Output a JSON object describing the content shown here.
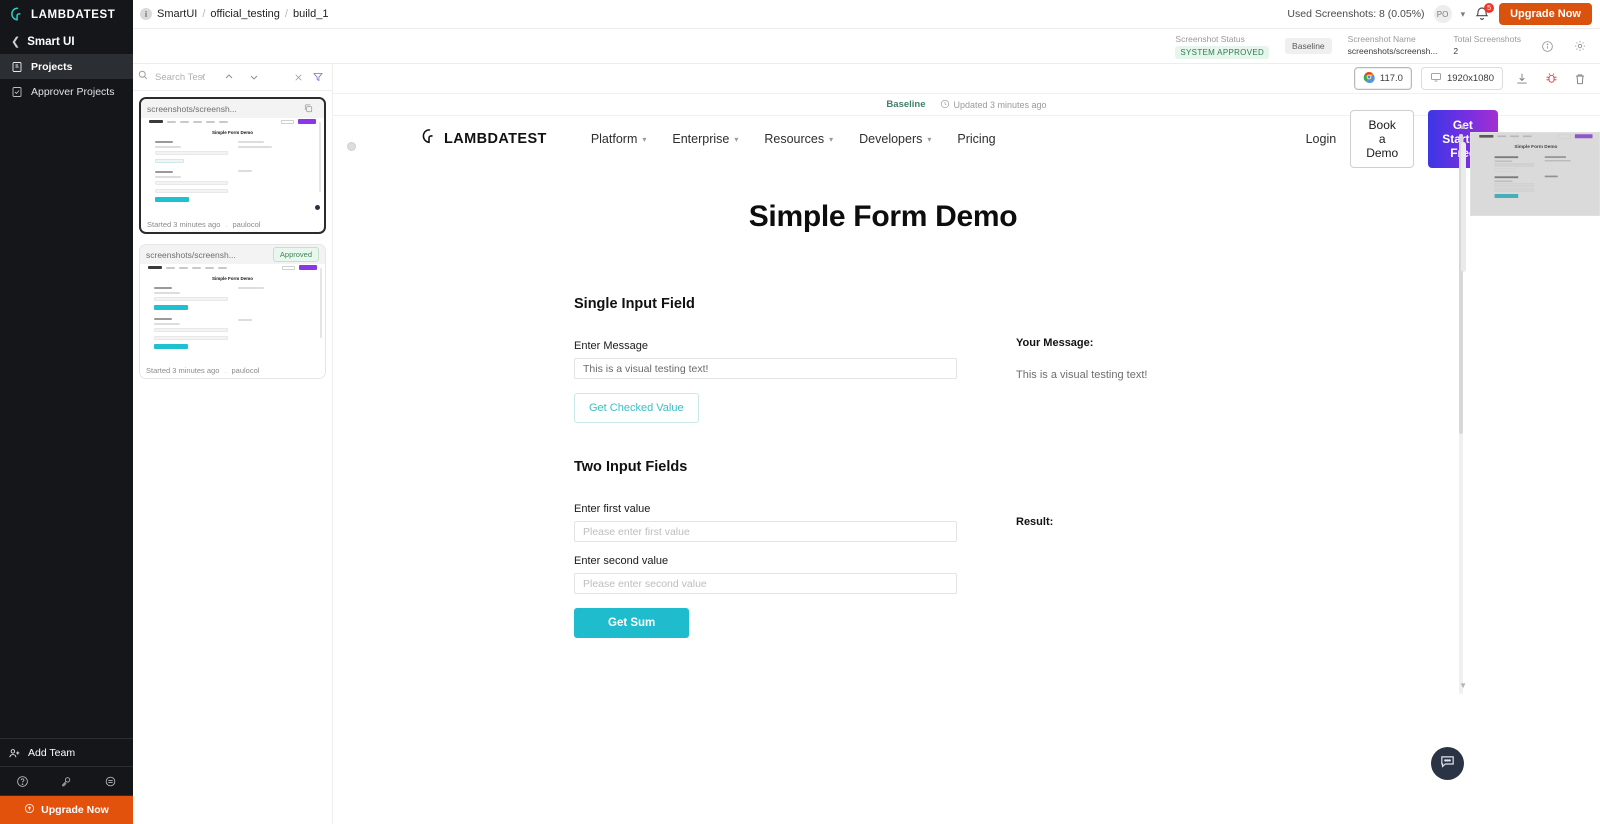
{
  "sidebar": {
    "brand": "LAMBDATEST",
    "back_label": "Smart UI",
    "items": [
      {
        "label": "Projects",
        "icon": "document-icon",
        "active": true
      },
      {
        "label": "Approver Projects",
        "icon": "document-check-icon",
        "active": false
      }
    ],
    "add_team": "Add Team",
    "upgrade": "Upgrade Now",
    "footer_icons": [
      "help-icon",
      "key-icon",
      "settings-icon"
    ]
  },
  "header": {
    "breadcrumb": {
      "root": "SmartUI",
      "project": "official_testing",
      "build": "build_1",
      "sep": "/"
    },
    "used_screenshots": "Used Screenshots: 8 (0.05%)",
    "avatar_initials": "PO",
    "notification_count": "5",
    "upgrade_button": "Upgrade Now"
  },
  "meta": {
    "status_label": "Screenshot Status",
    "status_value": "SYSTEM APPROVED",
    "baseline_badge": "Baseline",
    "name_label": "Screenshot Name",
    "name_value": "screenshots/screensh...",
    "total_label": "Total Screenshots",
    "total_value": "2",
    "info_icon": "info-icon",
    "settings_icon": "gear-icon"
  },
  "toolbar": {
    "browser_version": "117.0",
    "browser_icon": "chrome-icon",
    "resolution": "1920x1080",
    "resolution_icon": "monitor-icon",
    "download_icon": "download-icon",
    "bug_icon": "bug-icon",
    "delete_icon": "trash-icon"
  },
  "search": {
    "placeholder": "Search Test",
    "value": "",
    "search_icon": "search-icon",
    "clear_icon": "close-icon",
    "filter_icon": "filter-icon",
    "prev_icon": "chevron-left-icon",
    "up_icon": "chevron-up-icon",
    "down_icon": "chevron-down-icon"
  },
  "cards": [
    {
      "title": "screenshots/screensh...",
      "badge": "",
      "copy_icon": "copy-icon",
      "started": "Started 3 minutes ago",
      "separator": ".",
      "user": "paulocol",
      "selected": true
    },
    {
      "title": "screenshots/screensh...",
      "badge": "Approved",
      "copy_icon": "",
      "started": "Started 3 minutes ago",
      "separator": ".",
      "user": "paulocol",
      "selected": false
    }
  ],
  "viewer": {
    "baseline_label": "Baseline",
    "updated_label": "Updated 3 minutes ago",
    "clock_icon": "clock-icon",
    "chat_icon": "chat-icon"
  },
  "screenshot_page": {
    "brand": "LAMBDATEST",
    "nav": [
      {
        "label": "Platform",
        "has_caret": true
      },
      {
        "label": "Enterprise",
        "has_caret": true
      },
      {
        "label": "Resources",
        "has_caret": true
      },
      {
        "label": "Developers",
        "has_caret": true
      },
      {
        "label": "Pricing",
        "has_caret": false
      }
    ],
    "login": "Login",
    "book_demo": "Book a Demo",
    "get_started": "Get Started Free",
    "title": "Simple Form Demo",
    "section1": {
      "heading": "Single Input Field",
      "field_label": "Enter Message",
      "field_value": "This is a visual testing text!",
      "button": "Get Checked Value",
      "result_label": "Your Message:",
      "result_value": "This is a visual testing text!"
    },
    "section2": {
      "heading": "Two Input Fields",
      "first_label": "Enter first value",
      "first_placeholder": "Please enter first value",
      "second_label": "Enter second value",
      "second_placeholder": "Please enter second value",
      "button": "Get Sum",
      "result_label": "Result:"
    }
  },
  "colors": {
    "accent_orange": "#d9530e",
    "teal": "#1fbccd",
    "approved_green": "#3d8758",
    "dark_sidebar": "#14161a"
  }
}
